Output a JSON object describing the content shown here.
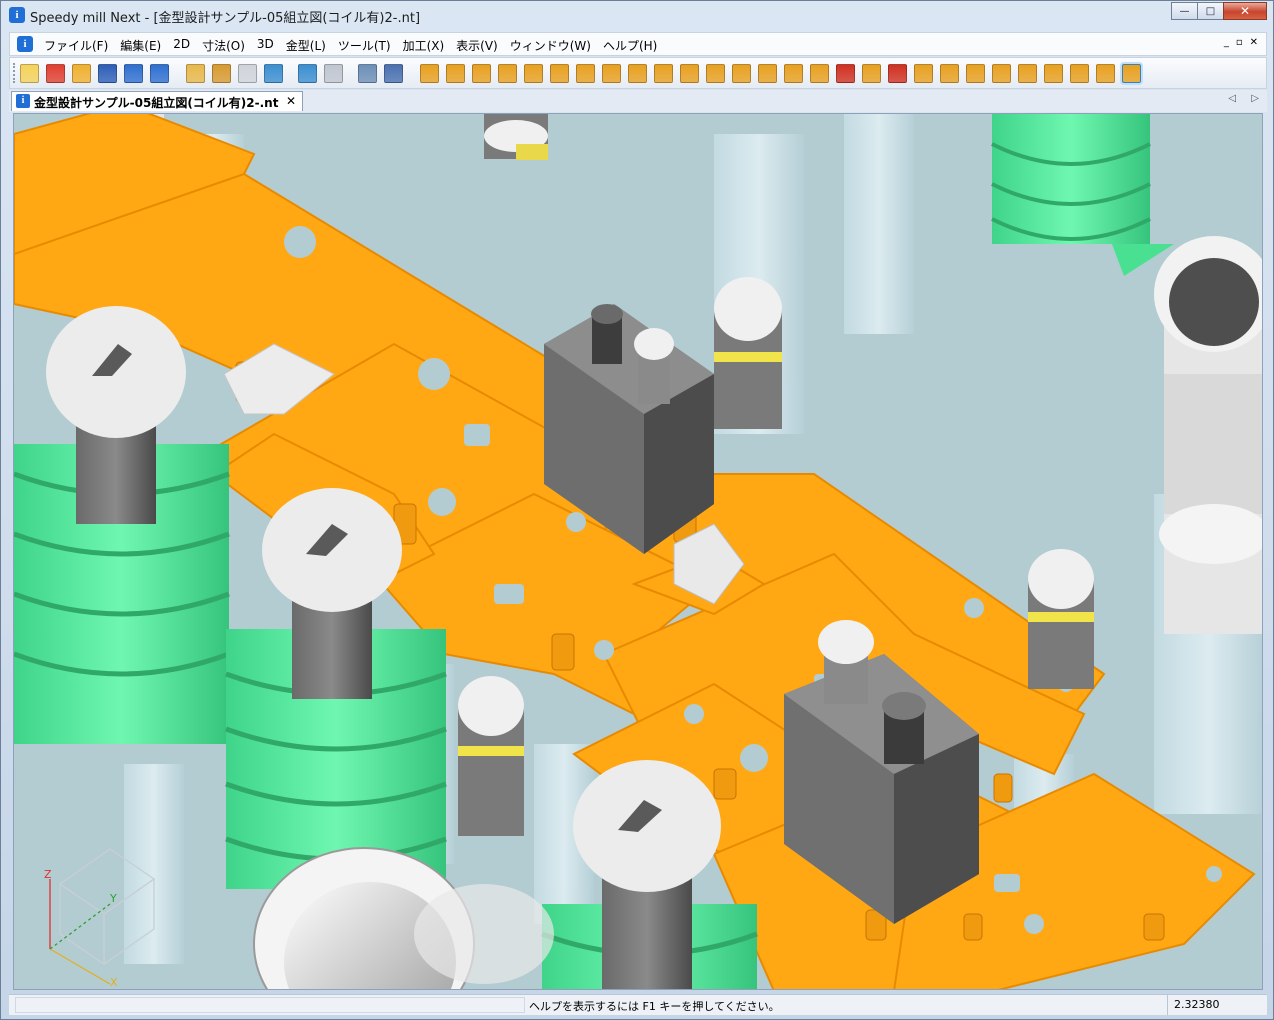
{
  "window": {
    "title": "Speedy mill Next - [金型設計サンプル-05組立図(コイル有)2-.nt]",
    "app_icon_glyph": "i",
    "caption_buttons": {
      "minimize": "—",
      "maximize": "□",
      "close": "✕"
    }
  },
  "menubar": {
    "items": [
      "ファイル(F)",
      "編集(E)",
      "2D",
      "寸法(O)",
      "3D",
      "金型(L)",
      "ツール(T)",
      "加工(X)",
      "表示(V)",
      "ウィンドウ(W)",
      "ヘルプ(H)"
    ],
    "mdi_controls": [
      "_",
      "▫",
      "✕"
    ]
  },
  "toolbar": {
    "icons": [
      {
        "name": "new-file-icon",
        "color": "#f5d25a"
      },
      {
        "name": "new-red-icon",
        "color": "#e04030"
      },
      {
        "name": "open-folder-icon",
        "color": "#f0b030"
      },
      {
        "name": "save-icon",
        "color": "#2d5fb8"
      },
      {
        "name": "undo-icon",
        "color": "#2f6fd0"
      },
      {
        "name": "redo-icon",
        "color": "#2f6fd0"
      },
      {
        "name": "measure-icon",
        "color": "#e8b84a"
      },
      {
        "name": "scale-icon",
        "color": "#d89a30"
      },
      {
        "name": "select-icon",
        "color": "#d0d4da"
      },
      {
        "name": "layer-icon",
        "color": "#3b8ed0"
      },
      {
        "name": "connect-icon",
        "color": "#3b8ed0"
      },
      {
        "name": "copy-icon",
        "color": "#c0c6d0"
      },
      {
        "name": "calculator-icon",
        "color": "#6d8fb8"
      },
      {
        "name": "help-cursor-icon",
        "color": "#4a70b0"
      },
      {
        "name": "machining-1-icon",
        "color": "#e8a020"
      },
      {
        "name": "machining-2-icon",
        "color": "#e8a020"
      },
      {
        "name": "machining-3-icon",
        "color": "#e8a020"
      },
      {
        "name": "machining-4-icon",
        "color": "#e8a020"
      },
      {
        "name": "machining-5-icon",
        "color": "#e8a020"
      },
      {
        "name": "machining-6-icon",
        "color": "#e8a020"
      },
      {
        "name": "machining-7-icon",
        "color": "#e8a020"
      },
      {
        "name": "machining-8-icon",
        "color": "#e8a020"
      },
      {
        "name": "machining-9-icon",
        "color": "#e8a020"
      },
      {
        "name": "machining-10-icon",
        "color": "#e8a020"
      },
      {
        "name": "machining-11-icon",
        "color": "#e8a020"
      },
      {
        "name": "machining-12-icon",
        "color": "#e8a020"
      },
      {
        "name": "machining-13-icon",
        "color": "#e8a020"
      },
      {
        "name": "machining-14-icon",
        "color": "#e8a020"
      },
      {
        "name": "machining-15-icon",
        "color": "#e8a020"
      },
      {
        "name": "machining-16-icon",
        "color": "#e8a020"
      },
      {
        "name": "delete-tool-icon",
        "color": "#d03020"
      },
      {
        "name": "tool-icon",
        "color": "#e8a020"
      },
      {
        "name": "refresh-icon",
        "color": "#d03020"
      },
      {
        "name": "machining-17-icon",
        "color": "#e8a020"
      },
      {
        "name": "machining-18-icon",
        "color": "#e8a020"
      },
      {
        "name": "machining-19-icon",
        "color": "#e8a020"
      },
      {
        "name": "machining-20-icon",
        "color": "#e8a020"
      },
      {
        "name": "machining-21-icon",
        "color": "#e8a020"
      },
      {
        "name": "machining-22-icon",
        "color": "#e8a020"
      },
      {
        "name": "machining-23-icon",
        "color": "#e8a020"
      },
      {
        "name": "machining-24-icon",
        "color": "#e8a020"
      },
      {
        "name": "machining-active-icon",
        "color": "#e8a020"
      }
    ]
  },
  "tabs": {
    "active_label": "金型設計サンプル-05組立図(コイル有)2-.nt",
    "close_glyph": "✕",
    "nav_prev": "◁",
    "nav_next": "▷"
  },
  "viewport": {
    "axis_labels": {
      "z": "Z",
      "y": "Y",
      "x": "X"
    },
    "colors": {
      "background": "#b3ccd1",
      "plate": "#ffa814",
      "plate_edge": "#e88a00",
      "coil": "#5ef2a0",
      "coil_dark": "#2fb46a",
      "bolt_light": "#f2f2f2",
      "bolt_dark": "#5c5c5c",
      "ghost": "#cfe3ea"
    }
  },
  "status": {
    "message": "ヘルプを表示するには F1 キーを押してください。",
    "value": "2.32380"
  }
}
